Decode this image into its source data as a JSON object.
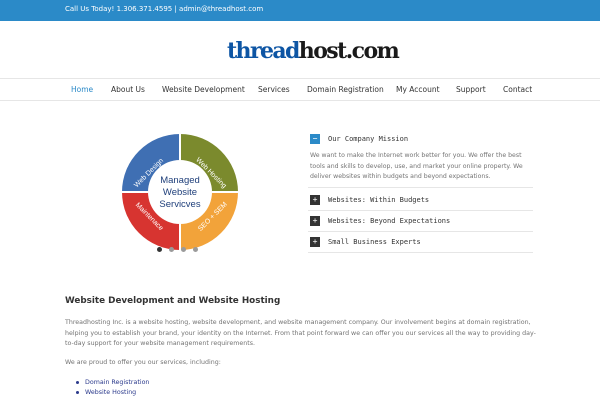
{
  "topbar": {
    "contact": "Call Us Today! 1.306.371.4595 | admin@threadhost.com"
  },
  "logo": {
    "part1": "thread",
    "part2": "host.com"
  },
  "nav": {
    "items": [
      {
        "label": "Home"
      },
      {
        "label": "About Us"
      },
      {
        "label": "Website Development"
      },
      {
        "label": "Services"
      },
      {
        "label": "Domain Registration"
      },
      {
        "label": "My Account"
      },
      {
        "label": "Support"
      },
      {
        "label": "Contact"
      }
    ],
    "active_index": 0
  },
  "slider": {
    "center_lines": [
      "Managed",
      "Website",
      "Servicves"
    ],
    "segments": [
      {
        "label": "Web Design",
        "color": "#3f6fb3"
      },
      {
        "label": "Web Hosting",
        "color": "#7b8a2d"
      },
      {
        "label": "SEO + SEM",
        "color": "#f2a33a"
      },
      {
        "label": "Maintenace",
        "color": "#d73430"
      }
    ],
    "dots_active_index": 0
  },
  "accordion": {
    "items": [
      {
        "title": "Our Company Mission",
        "toggle": "−",
        "open": true
      },
      {
        "title": "Websites: Within Budgets",
        "toggle": "+",
        "open": false
      },
      {
        "title": "Websites: Beyond Expectations",
        "toggle": "+",
        "open": false
      },
      {
        "title": "Small Business Experts",
        "toggle": "+",
        "open": false
      }
    ],
    "mission_body": "We want to make the Internet work better for you. We offer the best tools and skills to develop, use, and market your online property. We deliver websites within budgets and beyond expectations."
  },
  "main": {
    "title": "Website Development and Website Hosting",
    "intro": "Threadhosting Inc. is a website hosting, website development, and website management company.  Our involvement begins at domain registration, helping you to establish your brand, your identity on the Internet.  From that point forward we can offer you our services all the way to providing day-to-day support for your website management requirements.",
    "services_intro": "We are proud to offer you our services, including:",
    "services": [
      "Domain Registration",
      "Website Hosting"
    ]
  },
  "colors": {
    "accent": "#2b8ac8",
    "link": "#2b3a8c"
  }
}
